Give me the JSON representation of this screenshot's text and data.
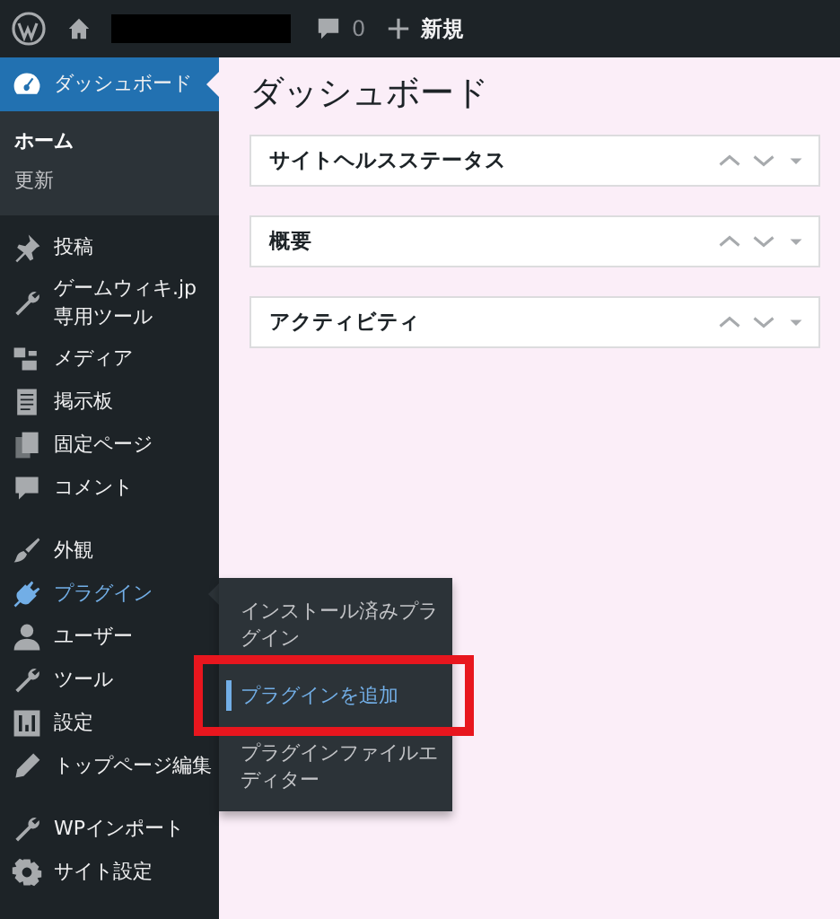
{
  "admin_bar": {
    "comments_count": "0",
    "new_label": "新規"
  },
  "sidebar": {
    "groups": [
      {
        "items": [
          {
            "label": "ダッシュボード",
            "selected": true,
            "hovered": false,
            "children": [
              {
                "label": "ホーム",
                "selected": true
              },
              {
                "label": "更新",
                "selected": false
              }
            ]
          },
          {
            "label": "投稿",
            "selected": false,
            "hovered": false
          },
          {
            "label": "ゲームウィキ.jp 専用ツール",
            "selected": false,
            "hovered": false
          },
          {
            "label": "メディア",
            "selected": false,
            "hovered": false
          },
          {
            "label": "掲示板",
            "selected": false,
            "hovered": false
          },
          {
            "label": "固定ページ",
            "selected": false,
            "hovered": false
          },
          {
            "label": "コメント",
            "selected": false,
            "hovered": false
          }
        ]
      },
      {
        "items": [
          {
            "label": "外観",
            "selected": false,
            "hovered": false
          },
          {
            "label": "プラグイン",
            "selected": false,
            "hovered": true
          },
          {
            "label": "ユーザー",
            "selected": false,
            "hovered": false
          },
          {
            "label": "ツール",
            "selected": false,
            "hovered": false
          },
          {
            "label": "設定",
            "selected": false,
            "hovered": false
          },
          {
            "label": "トップページ編集",
            "selected": false,
            "hovered": false
          }
        ]
      },
      {
        "items": [
          {
            "label": "WPインポート",
            "selected": false,
            "hovered": false
          },
          {
            "label": "サイト設定",
            "selected": false,
            "hovered": false
          }
        ]
      }
    ]
  },
  "flyout": {
    "items": [
      {
        "label": "インストール済みプラグイン",
        "selected": false,
        "highlighted": false
      },
      {
        "label": "プラグインを追加",
        "selected": true,
        "highlighted": true
      },
      {
        "label": "プラグインファイルエディター",
        "selected": false,
        "highlighted": false
      }
    ]
  },
  "main": {
    "title": "ダッシュボード",
    "boxes": [
      {
        "title": "サイトヘルスステータス"
      },
      {
        "title": "概要"
      },
      {
        "title": "アクティビティ"
      }
    ]
  }
}
